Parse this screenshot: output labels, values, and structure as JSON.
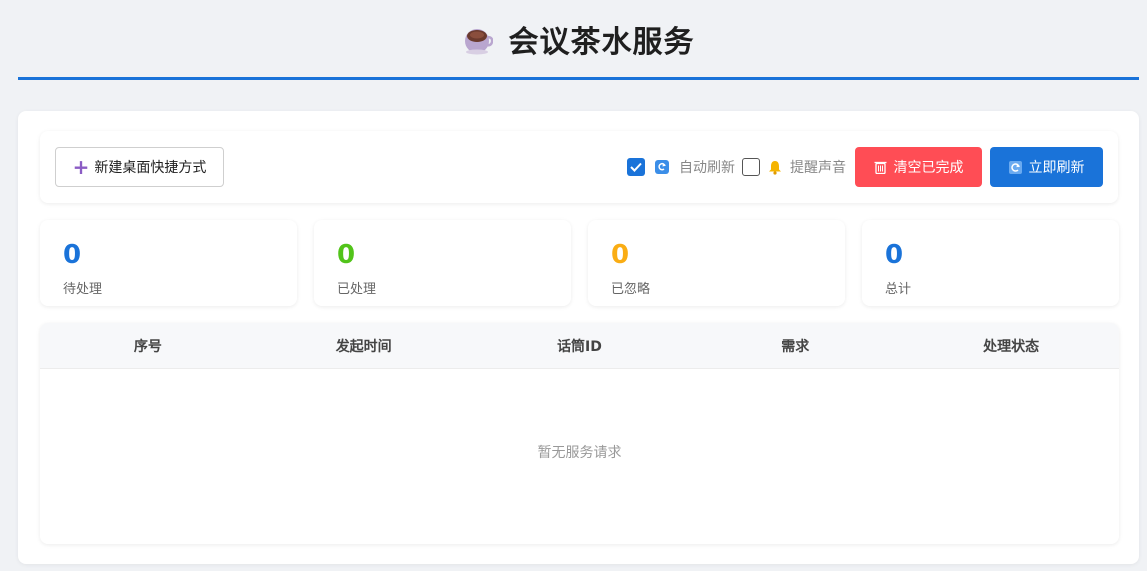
{
  "header": {
    "title": "会议茶水服务",
    "logo_icon": "coffee-cup-icon"
  },
  "toolbar": {
    "shortcut_label": "新建桌面快捷方式",
    "auto_refresh_label": "自动刷新",
    "auto_refresh_checked": true,
    "sound_label": "提醒声音",
    "sound_checked": false,
    "clear_label": "清空已完成",
    "refresh_label": "立即刷新"
  },
  "stats": [
    {
      "value": "0",
      "label": "待处理",
      "color": "#1a73d9"
    },
    {
      "value": "0",
      "label": "已处理",
      "color": "#52c41a"
    },
    {
      "value": "0",
      "label": "已忽略",
      "color": "#faad14"
    },
    {
      "value": "0",
      "label": "总计",
      "color": "#1a73d9"
    }
  ],
  "table": {
    "columns": [
      "序号",
      "发起时间",
      "话筒ID",
      "需求",
      "处理状态"
    ],
    "rows": [],
    "empty_text": "暂无服务请求"
  },
  "colors": {
    "accent": "#1a73d9",
    "danger": "#ff4d55"
  }
}
